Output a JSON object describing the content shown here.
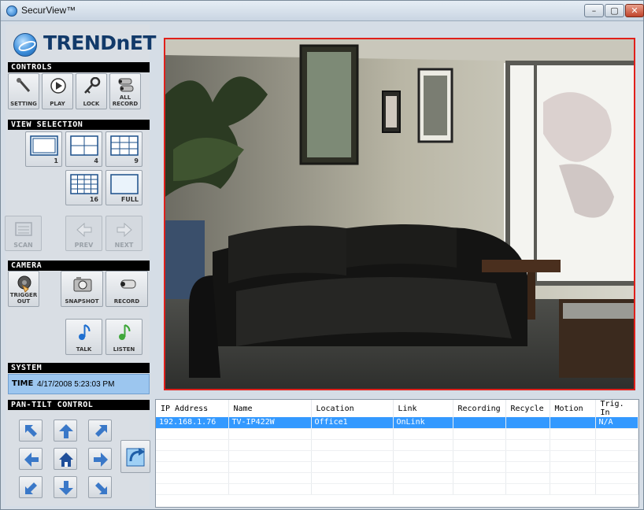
{
  "window": {
    "title": "SecurView™"
  },
  "brand": {
    "logo_text": "TRENDnET"
  },
  "sections": {
    "controls": "CONTROLS",
    "view_selection": "VIEW SELECTION",
    "camera": "CAMERA",
    "system": "SYSTEM",
    "pan_tilt": "PAN-TILT CONTROL"
  },
  "controls": {
    "setting": "SETTING",
    "play": "PLAY",
    "lock": "LOCK",
    "all_record_1": "ALL",
    "all_record_2": "RECORD"
  },
  "view_selection": {
    "v1": "1",
    "v4": "4",
    "v9": "9",
    "v16": "16",
    "full": "FULL",
    "scan": "SCAN",
    "prev": "PREV",
    "next": "NEXT"
  },
  "camera": {
    "trigger_out_1": "TRIGGER",
    "trigger_out_2": "OUT",
    "snapshot": "SNAPSHOT",
    "record": "RECORD",
    "talk": "TALK",
    "listen": "LISTEN"
  },
  "system": {
    "time_label": "TIME",
    "time_value": "4/17/2008 5:23:03 PM"
  },
  "table": {
    "headers": [
      "IP Address",
      "Name",
      "Location",
      "Link",
      "Recording",
      "Recycle",
      "Motion",
      "Trig. In"
    ],
    "rows": [
      [
        "192.168.1.76",
        "TV-IP422W",
        "Office1",
        "OnLink",
        "",
        "",
        "",
        "N/A"
      ]
    ]
  },
  "colors": {
    "accent_red": "#e0201b",
    "selection_blue": "#3399ff",
    "system_box": "#9cc6ef"
  }
}
